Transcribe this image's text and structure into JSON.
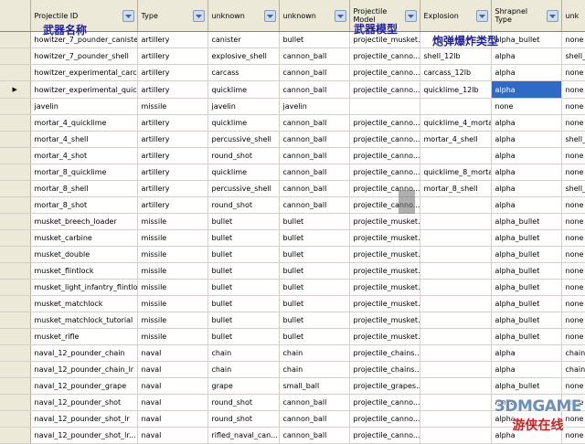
{
  "columns": [
    {
      "label": "Projectile ID"
    },
    {
      "label": "Type"
    },
    {
      "label": "unknown"
    },
    {
      "label": "unknown"
    },
    {
      "label": "Projectile Model"
    },
    {
      "label": "Explosion"
    },
    {
      "label": "Shrapnel Type"
    },
    {
      "label": "unk"
    }
  ],
  "rows": [
    {
      "c": [
        "howitzer_7_pounder_canister",
        "artillery",
        "canister",
        "bullet",
        "projectile_musket...",
        "",
        "alpha_bullet",
        "none"
      ]
    },
    {
      "c": [
        "howitzer_7_pounder_shell",
        "artillery",
        "explosive_shell",
        "cannon_ball",
        "projectile_canno...",
        "shell_12lb",
        "alpha",
        "shell_"
      ]
    },
    {
      "c": [
        "howitzer_experimental_carc...",
        "artillery",
        "carcass",
        "cannon_ball",
        "projectile_canno...",
        "carcass_12lb",
        "alpha",
        "none"
      ]
    },
    {
      "c": [
        "howitzer_experimental_quic...",
        "artillery",
        "quicklime",
        "cannon_ball",
        "projectile_canno...",
        "quicklime_12lb",
        "alpha",
        "none"
      ]
    },
    {
      "c": [
        "javelin",
        "missile",
        "javelin",
        "javelin",
        "",
        "",
        "none",
        "none"
      ]
    },
    {
      "c": [
        "mortar_4_quicklime",
        "artillery",
        "quicklime",
        "cannon_ball",
        "projectile_canno...",
        "quicklime_4_mortar",
        "alpha",
        "none"
      ]
    },
    {
      "c": [
        "mortar_4_shell",
        "artillery",
        "percussive_shell",
        "cannon_ball",
        "projectile_canno...",
        "mortar_4_shell",
        "alpha",
        "shell_"
      ]
    },
    {
      "c": [
        "mortar_4_shot",
        "artillery",
        "round_shot",
        "cannon_ball",
        "projectile_canno...",
        "",
        "alpha",
        "none"
      ]
    },
    {
      "c": [
        "mortar_8_quicklime",
        "artillery",
        "quicklime",
        "cannon_ball",
        "projectile_canno...",
        "quicklime_8_mortar",
        "alpha",
        "none"
      ]
    },
    {
      "c": [
        "mortar_8_shell",
        "artillery",
        "percussive_shell",
        "cannon_ball",
        "projectile_canno...",
        "mortar_8_shell",
        "alpha",
        "shell_"
      ]
    },
    {
      "c": [
        "mortar_8_shot",
        "artillery",
        "round_shot",
        "cannon_ball",
        "projectile_canno...",
        "",
        "alpha",
        "none"
      ]
    },
    {
      "c": [
        "musket_breech_loader",
        "missile",
        "bullet",
        "bullet",
        "projectile_musket...",
        "",
        "alpha_bullet",
        "none"
      ]
    },
    {
      "c": [
        "musket_carbine",
        "missile",
        "bullet",
        "bullet",
        "projectile_musket...",
        "",
        "alpha_bullet",
        "none"
      ]
    },
    {
      "c": [
        "musket_double",
        "missile",
        "bullet",
        "bullet",
        "projectile_musket...",
        "",
        "alpha_bullet",
        "none"
      ]
    },
    {
      "c": [
        "musket_flintlock",
        "missile",
        "bullet",
        "bullet",
        "projectile_musket...",
        "",
        "alpha_bullet",
        "none"
      ]
    },
    {
      "c": [
        "musket_light_infantry_flintlo...",
        "missile",
        "bullet",
        "bullet",
        "projectile_musket...",
        "",
        "alpha_bullet",
        "none"
      ]
    },
    {
      "c": [
        "musket_matchlock",
        "missile",
        "bullet",
        "bullet",
        "projectile_musket...",
        "",
        "alpha_bullet",
        "none"
      ]
    },
    {
      "c": [
        "musket_matchlock_tutorial",
        "missile",
        "bullet",
        "bullet",
        "projectile_musket...",
        "",
        "alpha_bullet",
        "none"
      ]
    },
    {
      "c": [
        "musket_rifle",
        "missile",
        "bullet",
        "bullet",
        "projectile_musket...",
        "",
        "alpha_bullet",
        "none"
      ]
    },
    {
      "c": [
        "naval_12_pounder_chain",
        "naval",
        "chain",
        "chain",
        "projectile_chains...",
        "",
        "alpha",
        "chain"
      ]
    },
    {
      "c": [
        "naval_12_pounder_chain_lr",
        "naval",
        "chain",
        "chain",
        "projectile_chains...",
        "",
        "alpha",
        "chain"
      ]
    },
    {
      "c": [
        "naval_12_pounder_grape",
        "naval",
        "grape",
        "small_ball",
        "projectile_grapes...",
        "",
        "alpha_bullet",
        "none"
      ]
    },
    {
      "c": [
        "naval_12_pounder_shot",
        "naval",
        "round_shot",
        "cannon_ball",
        "projectile_canno...",
        "",
        "alpha",
        "none"
      ]
    },
    {
      "c": [
        "naval_12_pounder_shot_lr",
        "naval",
        "round_shot",
        "cannon_ball",
        "projectile_canno...",
        "",
        "alpha",
        "none"
      ]
    },
    {
      "c": [
        "naval_12_pounder_shot_lr...",
        "naval",
        "rifled_naval_can...",
        "cannon_ball",
        "projectile_canno...",
        "",
        "alpha",
        "none"
      ]
    }
  ],
  "selection": {
    "row_marker": "▶"
  },
  "annotations": {
    "weapon_name": "武器名称",
    "weapon_model": "武器模型",
    "shell_explosion_type": "炮弹爆炸类型"
  },
  "watermark": {
    "top": "3DMGAME",
    "bottom": "游侠在线"
  },
  "colors": {
    "header_bg": "#ece9d8",
    "selection": "#316ac5",
    "annotation": "#1e1ea0",
    "grid_line": "#d4d0c8"
  }
}
